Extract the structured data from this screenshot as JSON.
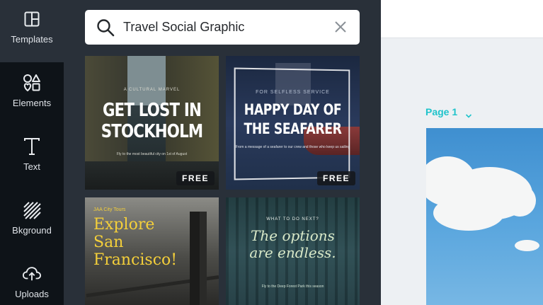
{
  "sidebar": {
    "items": [
      {
        "label": "Templates",
        "icon": "templates-icon"
      },
      {
        "label": "Elements",
        "icon": "elements-icon"
      },
      {
        "label": "Text",
        "icon": "text-icon"
      },
      {
        "label": "Bkground",
        "icon": "background-icon"
      },
      {
        "label": "Uploads",
        "icon": "uploads-icon"
      }
    ]
  },
  "search": {
    "value": "Travel Social Graphic"
  },
  "templates": [
    {
      "kicker": "A CULTURAL MARVEL",
      "title_lines": [
        "GET LOST IN",
        "STOCKHOLM"
      ],
      "subtitle": "Fly to the most beautiful city on 1st of August",
      "badge": "FREE"
    },
    {
      "kicker": "FOR SELFLESS SERVICE",
      "title_lines": [
        "HAPPY DAY OF",
        "THE SEAFARER"
      ],
      "subtitle": "From a message of a seafarer to our crew and those who keep us sailing",
      "badge": "FREE"
    },
    {
      "kicker": "JAA City Tours",
      "title_lines": [
        "Explore",
        "San",
        "Francisco!"
      ]
    },
    {
      "kicker": "WHAT TO DO NEXT?",
      "title_lines": [
        "The options",
        "are endless."
      ],
      "subtitle": "Fly to the Deep Forest Park this season"
    }
  ],
  "canvas": {
    "page_label": "Page 1"
  },
  "colors": {
    "nav_bg": "#0e1318",
    "panel_bg": "#293039",
    "accent": "#1fc3cb",
    "canvas_bg": "#edf0f3"
  }
}
